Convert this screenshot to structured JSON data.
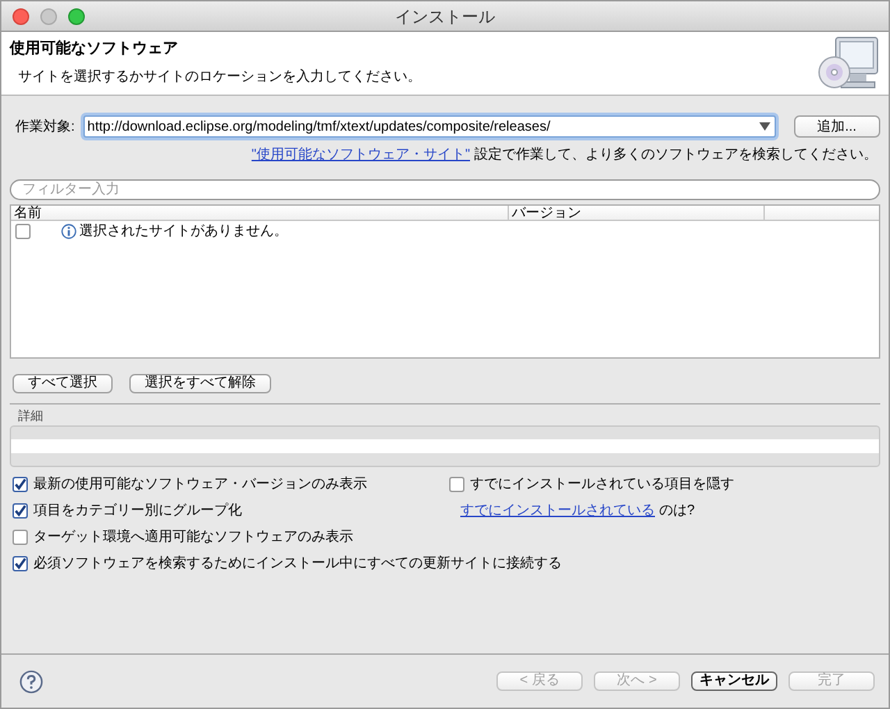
{
  "window": {
    "title": "インストール"
  },
  "header": {
    "title": "使用可能なソフトウェア",
    "subtitle": "サイトを選択するかサイトのロケーションを入力してください。"
  },
  "work_with": {
    "label": "作業対象:",
    "value": "http://download.eclipse.org/modeling/tmf/xtext/updates/composite/releases/",
    "add_button": "追加..."
  },
  "sites_hint": {
    "link": "\"使用可能なソフトウェア・サイト\"",
    "text": "設定で作業して、より多くのソフトウェアを検索してください。"
  },
  "filter": {
    "placeholder": "フィルター入力"
  },
  "table": {
    "columns": [
      "名前",
      "バージョン"
    ],
    "rows": [
      {
        "checked": false,
        "name": "選択されたサイトがありません。"
      }
    ]
  },
  "selection_buttons": [
    "すべて選択",
    "選択をすべて解除"
  ],
  "details": {
    "label": "詳細"
  },
  "options_left": [
    {
      "label": "最新の使用可能なソフトウェア・バージョンのみ表示",
      "checked": true
    },
    {
      "label": "項目をカテゴリー別にグループ化",
      "checked": true
    },
    {
      "label": "ターゲット環境へ適用可能なソフトウェアのみ表示",
      "checked": false
    },
    {
      "label": "必須ソフトウェアを検索するためにインストール中にすべての更新サイトに接続する",
      "checked": true
    }
  ],
  "options_right": {
    "hide_installed": {
      "label": "すでにインストールされている項目を隠す",
      "checked": false
    },
    "installed_link": "すでにインストールされている",
    "installed_suffix": "のは?"
  },
  "footer_buttons": [
    {
      "label": "< 戻る",
      "disabled": true,
      "default": false
    },
    {
      "label": "次へ >",
      "disabled": true,
      "default": false
    },
    {
      "label": "キャンセル",
      "disabled": false,
      "default": true
    },
    {
      "label": "完了",
      "disabled": true,
      "default": false
    }
  ]
}
